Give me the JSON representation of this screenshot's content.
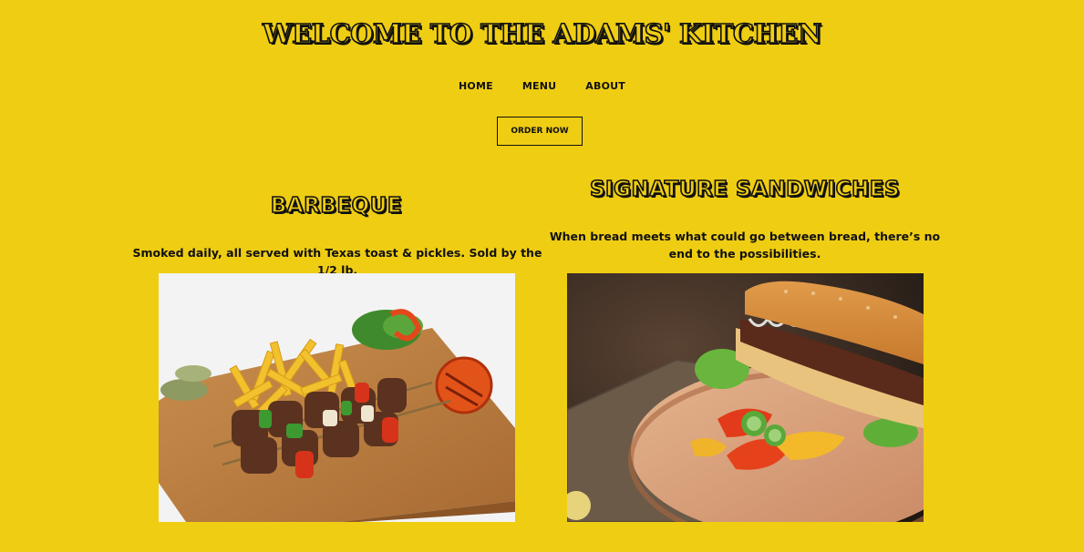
{
  "header": {
    "title": "WELCOME TO THE ADAMS' KITCHEN"
  },
  "nav": {
    "items": [
      {
        "label": "HOME"
      },
      {
        "label": "MENU"
      },
      {
        "label": "ABOUT"
      }
    ]
  },
  "hero": {
    "order_button_label": "ORDER NOW"
  },
  "sections": [
    {
      "heading": "BARBEQUE",
      "description": "Smoked daily, all served with Texas toast & pickles. Sold by the 1/2 lb.",
      "image_alt": "Barbeque skewers with fries on a wooden board"
    },
    {
      "heading": "SIGNATURE SANDWICHES",
      "description": "When bread meets what could go between bread, there’s no end to the possibilities.",
      "image_alt": "Sandwich on a wooden board with peppers"
    }
  ],
  "colors": {
    "background": "#EFCD13",
    "text": "#111111"
  }
}
